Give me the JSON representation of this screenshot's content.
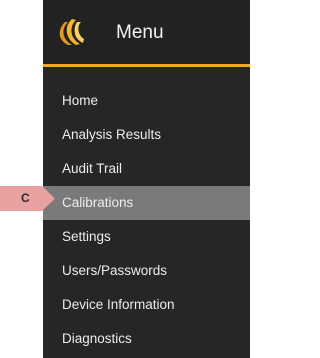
{
  "menu": {
    "title": "Menu",
    "items": [
      {
        "label": "Home"
      },
      {
        "label": "Analysis Results"
      },
      {
        "label": "Audit Trail"
      },
      {
        "label": "Calibrations",
        "active": true
      },
      {
        "label": "Settings"
      },
      {
        "label": "Users/Passwords"
      },
      {
        "label": "Device Information"
      },
      {
        "label": "Diagnostics"
      }
    ]
  },
  "callout": {
    "label": "C"
  },
  "colors": {
    "panel_background": "#262626",
    "accent": "#f0a81e",
    "active_background": "#7a7a7a",
    "callout_fill": "#e8a0a0"
  },
  "icons": {
    "logo": "menu-logo-icon"
  }
}
